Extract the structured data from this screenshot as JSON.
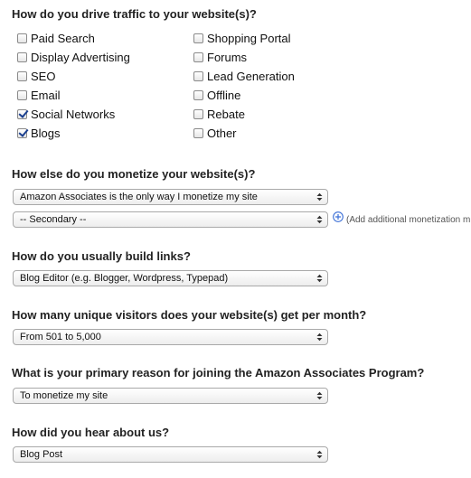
{
  "traffic": {
    "question": "How do you drive traffic to your website(s)?",
    "col1": [
      {
        "label": "Paid Search",
        "checked": false
      },
      {
        "label": "Display Advertising",
        "checked": false
      },
      {
        "label": "SEO",
        "checked": false
      },
      {
        "label": "Email",
        "checked": false
      },
      {
        "label": "Social Networks",
        "checked": true
      },
      {
        "label": "Blogs",
        "checked": true
      }
    ],
    "col2": [
      {
        "label": "Shopping Portal",
        "checked": false
      },
      {
        "label": "Forums",
        "checked": false
      },
      {
        "label": "Lead Generation",
        "checked": false
      },
      {
        "label": "Offline",
        "checked": false
      },
      {
        "label": "Rebate",
        "checked": false
      },
      {
        "label": "Other",
        "checked": false
      }
    ]
  },
  "monetize": {
    "question": "How else do you monetize your website(s)?",
    "primary_value": "Amazon Associates is the only way I monetize my site",
    "secondary_value": "-- Secondary --",
    "add_label": "(Add additional monetization m"
  },
  "links": {
    "question": "How do you usually build links?",
    "value": "Blog Editor (e.g. Blogger, Wordpress, Typepad)"
  },
  "visitors": {
    "question": "How many unique visitors does your website(s) get per month?",
    "value": "From 501 to 5,000"
  },
  "reason": {
    "question": "What is your primary reason for joining the Amazon Associates Program?",
    "value": "To monetize my site"
  },
  "hear": {
    "question": "How did you hear about us?",
    "value": "Blog Post"
  },
  "colors": {
    "check": "#1a3f8f",
    "add_icon": "#3b6fd6"
  }
}
